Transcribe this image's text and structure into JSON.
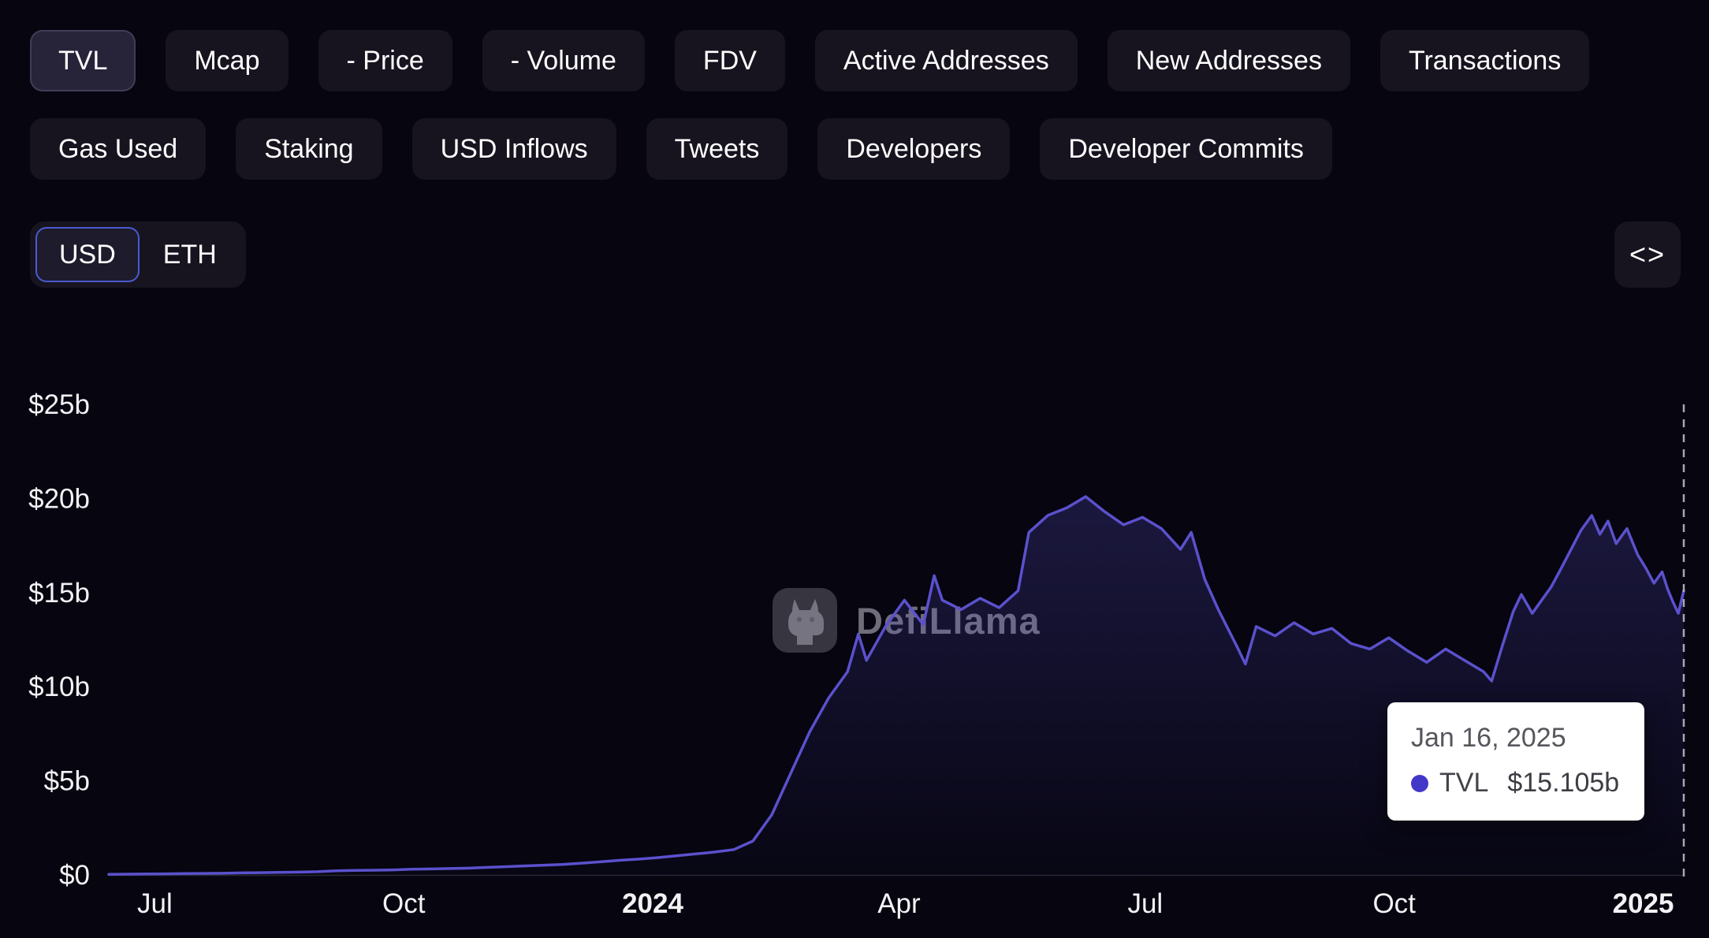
{
  "tabs": {
    "row1": [
      {
        "label": "TVL",
        "selected": true
      },
      {
        "label": "Mcap",
        "selected": false
      },
      {
        "label": "- Price",
        "selected": false
      },
      {
        "label": "- Volume",
        "selected": false
      },
      {
        "label": "FDV",
        "selected": false
      },
      {
        "label": "Active Addresses",
        "selected": false
      },
      {
        "label": "New Addresses",
        "selected": false
      },
      {
        "label": "Transactions",
        "selected": false
      }
    ],
    "row2": [
      {
        "label": "Gas Used",
        "selected": false
      },
      {
        "label": "Staking",
        "selected": false
      },
      {
        "label": "USD Inflows",
        "selected": false
      },
      {
        "label": "Tweets",
        "selected": false
      },
      {
        "label": "Developers",
        "selected": false
      },
      {
        "label": "Developer Commits",
        "selected": false
      }
    ]
  },
  "denomination": {
    "options": [
      "USD",
      "ETH"
    ],
    "selected": "USD"
  },
  "embed_button": {
    "icon": "code-icon",
    "glyph": "<>"
  },
  "watermark": {
    "text": "DefiLlama"
  },
  "tooltip": {
    "date": "Jan 16, 2025",
    "series": "TVL",
    "value": "$15.105b",
    "dot_color": "#4237c8"
  },
  "colors": {
    "background": "#060510",
    "button_bg": "#17141f",
    "button_selected_bg": "#272339",
    "denom_selected_border": "#4a5ad1",
    "line": "#5b51cd",
    "area_top": "rgba(91,81,205,0.30)",
    "area_bottom": "rgba(91,81,205,0.02)",
    "crosshair": "#b9b9c3",
    "axis_label": "#f2f2f5",
    "axis_line": "rgba(255,255,255,0.14)"
  },
  "chart_data": {
    "type": "area",
    "title": "TVL",
    "unit": "USD billions",
    "xlabel": "",
    "ylabel": "",
    "ylim": [
      0,
      25
    ],
    "grid": false,
    "legend_position": "none",
    "x_range": [
      "2023-06-14",
      "2025-01-16"
    ],
    "y_ticks": [
      {
        "value": 0,
        "label": "$0"
      },
      {
        "value": 5,
        "label": "$5b"
      },
      {
        "value": 10,
        "label": "$10b"
      },
      {
        "value": 15,
        "label": "$15b"
      },
      {
        "value": 20,
        "label": "$20b"
      },
      {
        "value": 25,
        "label": "$25b"
      }
    ],
    "x_ticks": [
      {
        "date": "2023-07-01",
        "label": "Jul",
        "bold": false
      },
      {
        "date": "2023-10-01",
        "label": "Oct",
        "bold": false
      },
      {
        "date": "2024-01-01",
        "label": "2024",
        "bold": true
      },
      {
        "date": "2024-04-01",
        "label": "Apr",
        "bold": false
      },
      {
        "date": "2024-07-01",
        "label": "Jul",
        "bold": false
      },
      {
        "date": "2024-10-01",
        "label": "Oct",
        "bold": false
      },
      {
        "date": "2025-01-01",
        "label": "2025",
        "bold": true
      }
    ],
    "series": [
      {
        "name": "TVL",
        "color": "#5b51cd",
        "points": [
          [
            "2023-06-14",
            0.03
          ],
          [
            "2023-06-21",
            0.04
          ],
          [
            "2023-06-28",
            0.05
          ],
          [
            "2023-07-05",
            0.06
          ],
          [
            "2023-07-12",
            0.07
          ],
          [
            "2023-07-19",
            0.08
          ],
          [
            "2023-07-26",
            0.09
          ],
          [
            "2023-08-02",
            0.11
          ],
          [
            "2023-08-09",
            0.12
          ],
          [
            "2023-08-16",
            0.14
          ],
          [
            "2023-08-23",
            0.15
          ],
          [
            "2023-08-30",
            0.17
          ],
          [
            "2023-09-06",
            0.22
          ],
          [
            "2023-09-13",
            0.24
          ],
          [
            "2023-09-20",
            0.25
          ],
          [
            "2023-09-27",
            0.27
          ],
          [
            "2023-10-04",
            0.3
          ],
          [
            "2023-10-11",
            0.32
          ],
          [
            "2023-10-18",
            0.34
          ],
          [
            "2023-10-25",
            0.36
          ],
          [
            "2023-11-01",
            0.4
          ],
          [
            "2023-11-08",
            0.44
          ],
          [
            "2023-11-15",
            0.48
          ],
          [
            "2023-11-22",
            0.52
          ],
          [
            "2023-11-29",
            0.56
          ],
          [
            "2023-12-06",
            0.63
          ],
          [
            "2023-12-13",
            0.7
          ],
          [
            "2023-12-20",
            0.78
          ],
          [
            "2023-12-27",
            0.84
          ],
          [
            "2024-01-03",
            0.92
          ],
          [
            "2024-01-10",
            1.02
          ],
          [
            "2024-01-17",
            1.12
          ],
          [
            "2024-01-24",
            1.22
          ],
          [
            "2024-01-31",
            1.35
          ],
          [
            "2024-02-07",
            1.8
          ],
          [
            "2024-02-14",
            3.2
          ],
          [
            "2024-02-21",
            5.4
          ],
          [
            "2024-02-28",
            7.6
          ],
          [
            "2024-03-06",
            9.4
          ],
          [
            "2024-03-13",
            10.8
          ],
          [
            "2024-03-17",
            12.8
          ],
          [
            "2024-03-20",
            11.4
          ],
          [
            "2024-03-27",
            13.2
          ],
          [
            "2024-04-03",
            14.6
          ],
          [
            "2024-04-10",
            13.3
          ],
          [
            "2024-04-14",
            15.9
          ],
          [
            "2024-04-17",
            14.6
          ],
          [
            "2024-04-24",
            14.1
          ],
          [
            "2024-05-01",
            14.7
          ],
          [
            "2024-05-08",
            14.2
          ],
          [
            "2024-05-15",
            15.1
          ],
          [
            "2024-05-19",
            18.2
          ],
          [
            "2024-05-26",
            19.1
          ],
          [
            "2024-06-02",
            19.5
          ],
          [
            "2024-06-09",
            20.1
          ],
          [
            "2024-06-16",
            19.3
          ],
          [
            "2024-06-23",
            18.6
          ],
          [
            "2024-06-30",
            19.0
          ],
          [
            "2024-07-07",
            18.4
          ],
          [
            "2024-07-14",
            17.3
          ],
          [
            "2024-07-18",
            18.2
          ],
          [
            "2024-07-23",
            15.7
          ],
          [
            "2024-07-28",
            14.1
          ],
          [
            "2024-08-04",
            12.1
          ],
          [
            "2024-08-07",
            11.2
          ],
          [
            "2024-08-11",
            13.2
          ],
          [
            "2024-08-18",
            12.7
          ],
          [
            "2024-08-25",
            13.4
          ],
          [
            "2024-09-01",
            12.8
          ],
          [
            "2024-09-08",
            13.1
          ],
          [
            "2024-09-15",
            12.3
          ],
          [
            "2024-09-22",
            12.0
          ],
          [
            "2024-09-29",
            12.6
          ],
          [
            "2024-10-06",
            11.9
          ],
          [
            "2024-10-13",
            11.3
          ],
          [
            "2024-10-20",
            12.0
          ],
          [
            "2024-10-27",
            11.4
          ],
          [
            "2024-11-03",
            10.8
          ],
          [
            "2024-11-06",
            10.3
          ],
          [
            "2024-11-10",
            12.2
          ],
          [
            "2024-11-14",
            14.0
          ],
          [
            "2024-11-17",
            14.9
          ],
          [
            "2024-11-21",
            13.9
          ],
          [
            "2024-11-24",
            14.5
          ],
          [
            "2024-11-28",
            15.3
          ],
          [
            "2024-12-01",
            16.1
          ],
          [
            "2024-12-05",
            17.2
          ],
          [
            "2024-12-09",
            18.3
          ],
          [
            "2024-12-13",
            19.1
          ],
          [
            "2024-12-16",
            18.1
          ],
          [
            "2024-12-19",
            18.8
          ],
          [
            "2024-12-22",
            17.6
          ],
          [
            "2024-12-26",
            18.4
          ],
          [
            "2024-12-30",
            17.0
          ],
          [
            "2025-01-02",
            16.3
          ],
          [
            "2025-01-05",
            15.5
          ],
          [
            "2025-01-08",
            16.1
          ],
          [
            "2025-01-10",
            15.2
          ],
          [
            "2025-01-12",
            14.5
          ],
          [
            "2025-01-14",
            13.9
          ],
          [
            "2025-01-16",
            15.105
          ]
        ]
      }
    ],
    "highlight": {
      "date": "2025-01-16",
      "label": "Jan 16, 2025",
      "series": "TVL",
      "value": 15.105,
      "value_label": "$15.105b"
    }
  }
}
